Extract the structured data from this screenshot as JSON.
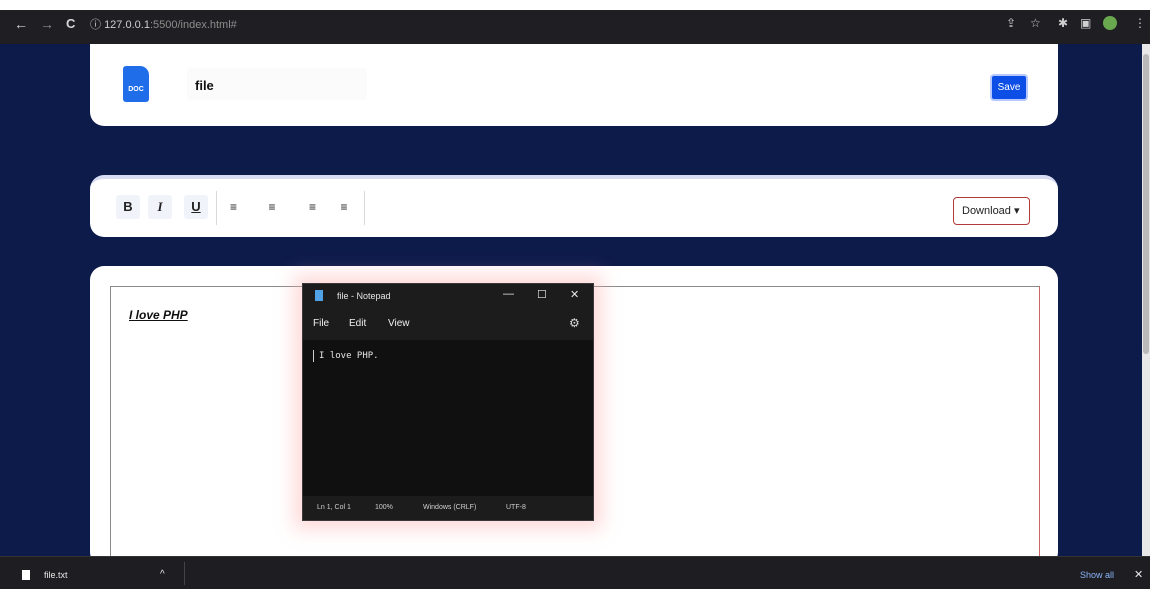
{
  "browser": {
    "back": "←",
    "forward": "→",
    "reload": "C",
    "info_icon": "ⓘ",
    "url_host": "127.0.0.1",
    "url_path": ":5500/index.html#",
    "share": "⇪",
    "star": "☆",
    "extensions": "✱",
    "sidepanel": "▣",
    "menu": "⋮"
  },
  "header": {
    "doc_icon_label": "DOC",
    "filename": "file",
    "save_label": "Save"
  },
  "toolbar": {
    "bold": "B",
    "italic": "I",
    "underline": "U",
    "align_left": "≡",
    "align_center": "≡",
    "align_right": "≡",
    "justify": "≡",
    "download_label": "Download ▾"
  },
  "editor": {
    "content": "I love PHP"
  },
  "notepad": {
    "title": "file - Notepad",
    "minimize": "—",
    "maximize": "☐",
    "close": "✕",
    "menu": [
      "File",
      "Edit",
      "View"
    ],
    "settings": "⚙",
    "text": "I love PHP.",
    "status": [
      "Ln 1, Col 1",
      "100%",
      "Windows (CRLF)",
      "UTF-8"
    ]
  },
  "downloads": {
    "file_name": "file.txt",
    "chevron": "^",
    "show_all": "Show all",
    "close": "✕"
  }
}
